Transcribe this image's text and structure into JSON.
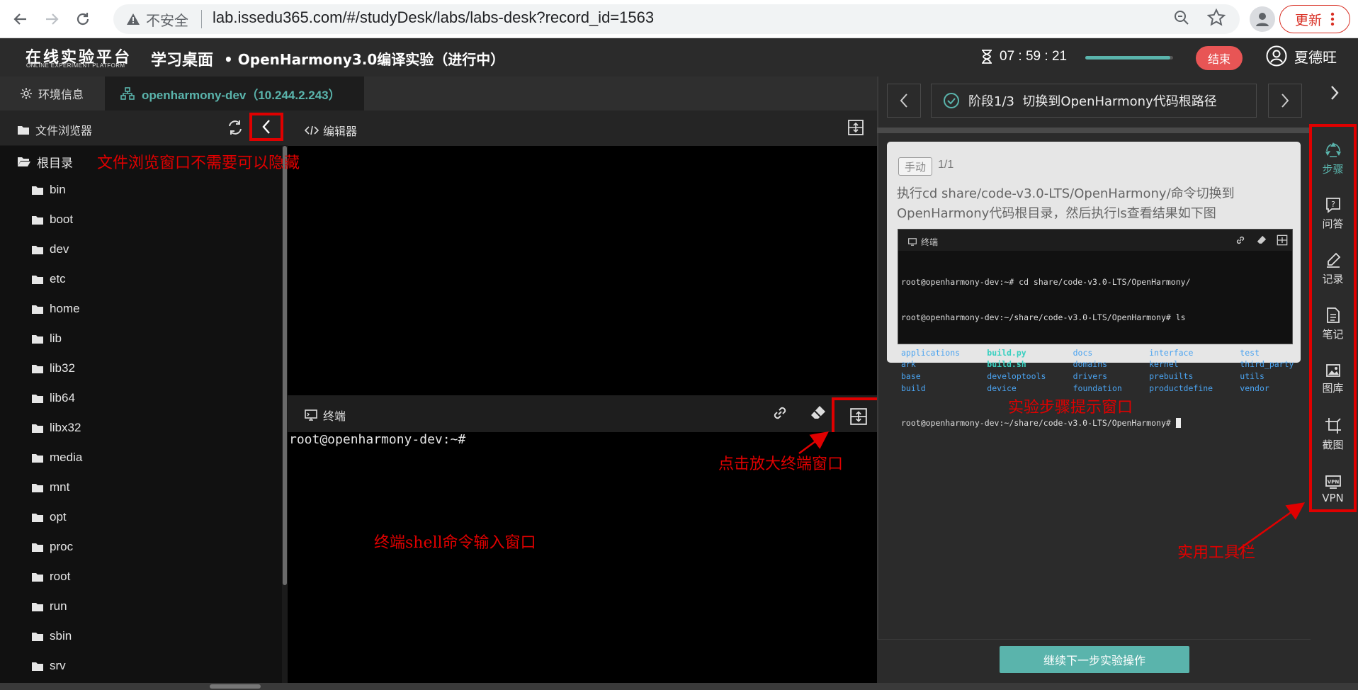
{
  "browser": {
    "insecure_label": "不安全",
    "url": "lab.issedu365.com/#/studyDesk/labs/labs-desk?record_id=1563",
    "update_label": "更新"
  },
  "header": {
    "logo_main": "在线实验平台",
    "logo_sub": "ONLINE EXPERIMENT PLATFORM",
    "app_title": "学习桌面",
    "lab_title": "• OpenHarmony3.0编译实验（进行中）",
    "timer": "07 : 59 : 21",
    "progress": 0.97,
    "end_label": "结束",
    "user_name": "夏德旺"
  },
  "tabs": {
    "env_label": "环境信息",
    "dev_label": "openharmony-dev（10.244.2.243）"
  },
  "file_browser": {
    "title": "文件浏览器",
    "root_label": "根目录",
    "items": [
      "bin",
      "boot",
      "dev",
      "etc",
      "home",
      "lib",
      "lib32",
      "lib64",
      "libx32",
      "media",
      "mnt",
      "opt",
      "proc",
      "root",
      "run",
      "sbin",
      "srv"
    ]
  },
  "editor": {
    "title": "编辑器"
  },
  "terminal": {
    "title": "终端",
    "prompt": "root@openharmony-dev:~#"
  },
  "step": {
    "title": "阶段1/3  切换到OpenHarmony代码根路径",
    "badge": "手动",
    "count": "1/1",
    "desc_line1": "执行cd share/code-v3.0-LTS/OpenHarmony/命令切换到",
    "desc_line2": "OpenHarmony代码根目录，然后执行ls查看结果如下图",
    "image": {
      "title": "终端",
      "line1": "root@openharmony-dev:~# cd share/code-v3.0-LTS/OpenHarmony/",
      "line2": "root@openharmony-dev:~/share/code-v3.0-LTS/OpenHarmony# ls",
      "rows": [
        [
          "applications",
          "build.py",
          "docs",
          "interface",
          "test"
        ],
        [
          "ark",
          "build.sh",
          "domains",
          "kernel",
          "third_party"
        ],
        [
          "base",
          "developtools",
          "drivers",
          "prebuilts",
          "utils"
        ],
        [
          "build",
          "device",
          "foundation",
          "productdefine",
          "vendor"
        ]
      ],
      "last_line": "root@openharmony-dev:~/share/code-v3.0-LTS/OpenHarmony#"
    },
    "next_label": "继续下一步实验操作"
  },
  "toolbar": {
    "items": [
      {
        "label": "步骤",
        "icon": "steps-icon"
      },
      {
        "label": "问答",
        "icon": "qa-icon"
      },
      {
        "label": "记录",
        "icon": "record-icon"
      },
      {
        "label": "笔记",
        "icon": "notes-icon"
      },
      {
        "label": "图库",
        "icon": "gallery-icon"
      },
      {
        "label": "截图",
        "icon": "crop-icon"
      },
      {
        "label": "VPN",
        "icon": "vpn-icon"
      }
    ]
  },
  "annotations": {
    "file_browser_hint": "文件浏览窗口不需要可以隐藏",
    "maximize_hint": "点击放大终端窗口",
    "terminal_hint": "终端shell命令输入窗口",
    "step_hint": "实验步骤提示窗口",
    "toolbar_hint": "实用工具栏"
  },
  "colors": {
    "accent": "#5ab4ac",
    "annotation": "#e00000",
    "end_button": "#e85555"
  }
}
